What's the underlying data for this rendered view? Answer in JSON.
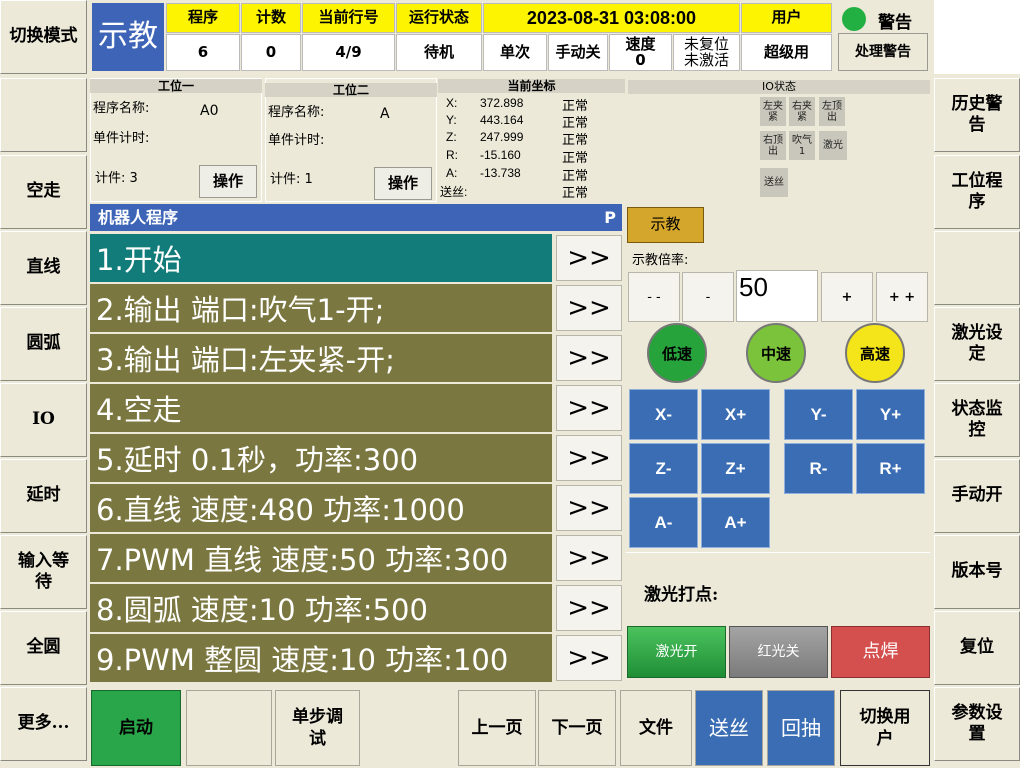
{
  "left_menu": [
    "切换模式",
    "",
    "空走",
    "直线",
    "圆弧",
    "IO",
    "延时",
    "输入等待",
    "全圆",
    "更多..."
  ],
  "right_menu": [
    "",
    "历史警告",
    "工位程序",
    "",
    "激光设定",
    "状态监控",
    "手动开",
    "版本号",
    "复位",
    "参数设置"
  ],
  "header": {
    "mode": "示教",
    "program_label": "程序",
    "program_value": "6",
    "count_label": "计数",
    "count_value": "0",
    "line_label": "当前行号",
    "line_value": "4/9",
    "status_label": "运行状态",
    "status_value": "待机",
    "datetime": "2023-08-31 03:08:00",
    "single": "单次",
    "manual": "手动关",
    "speed_label": "速度",
    "speed_value": "0",
    "reset_line1": "未复位",
    "reset_line2": "未激活",
    "user_label": "用户",
    "user_value": "超级用",
    "alarm_label": "警告",
    "alarm_button": "处理警告"
  },
  "station1": {
    "title": "工位一",
    "name_label": "程序名称:",
    "name_value": "A0",
    "timer_label": "单件计时:",
    "count_label": "计件: 3",
    "op_button": "操作"
  },
  "station2": {
    "title": "工位二",
    "name_label": "程序名称:",
    "name_value": "A",
    "timer_label": "单件计时:",
    "count_label": "计件: 1",
    "op_button": "操作"
  },
  "coords": {
    "title": "当前坐标",
    "rows": [
      {
        "axis": "X:",
        "value": "372.898",
        "status": "正常"
      },
      {
        "axis": "Y:",
        "value": "443.164",
        "status": "正常"
      },
      {
        "axis": "Z:",
        "value": "247.999",
        "status": "正常"
      },
      {
        "axis": "R:",
        "value": "-15.160",
        "status": "正常"
      },
      {
        "axis": "A:",
        "value": "-13.738",
        "status": "正常"
      },
      {
        "axis": "送丝:",
        "value": "",
        "status": "正常"
      }
    ]
  },
  "io": {
    "title": "IO状态",
    "items": [
      "左夹紧",
      "右夹紧",
      "左顶出",
      "右顶出",
      "吹气1",
      "激光",
      "送丝"
    ]
  },
  "program": {
    "title": "机器人程序",
    "flag": "P",
    "arrow": ">>",
    "lines": [
      "1.开始",
      "2.输出 端口:吹气1-开;",
      "3.输出 端口:左夹紧-开;",
      "4.空走",
      "5.延时 0.1秒，功率:300",
      "6.直线 速度:480 功率:1000",
      "7.PWM 直线 速度:50 功率:300",
      "8.圆弧 速度:10 功率:500",
      "9.PWM 整圆 速度:10 功率:100"
    ],
    "selected_index": 0
  },
  "teach": {
    "button": "示教",
    "rate_label": "示教倍率:",
    "rate_value": "50",
    "minus2": "- -",
    "minus1": "-",
    "plus1": "+",
    "plus2": "+ +",
    "low": "低速",
    "mid": "中速",
    "high": "高速",
    "jog": [
      "X-",
      "X+",
      "Y-",
      "Y+",
      "Z-",
      "Z+",
      "R-",
      "R+",
      "A-",
      "A+"
    ],
    "laser_point_label": "激光打点:",
    "laser_on": "激光开",
    "red_off": "红光关",
    "spot_weld": "点焊"
  },
  "bottom": {
    "start": "启动",
    "blank": "",
    "step_debug": "单步调试",
    "prev": "上一页",
    "next": "下一页",
    "file": "文件",
    "feed": "送丝",
    "retract": "回抽",
    "switch_user": "切换用户"
  },
  "colors": {
    "selected_row": "#117c7a",
    "program_row": "#7b7740",
    "jog": "#3a6db4",
    "start": "#2aa64a",
    "low": "#27a33c",
    "mid": "#7bc33a",
    "high": "#f3e51a",
    "laser_on": "#2f9e45",
    "red_off": "#8c8c8c",
    "spot_weld": "#d4504f"
  }
}
